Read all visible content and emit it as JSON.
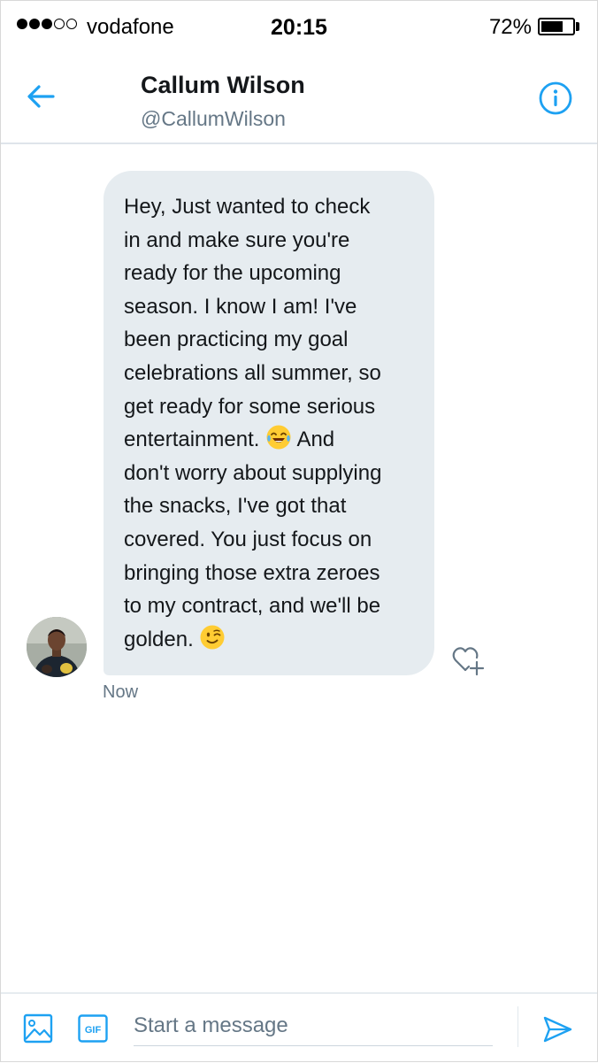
{
  "status_bar": {
    "signal_full": 3,
    "signal_total": 5,
    "carrier": "vodafone",
    "time": "20:15",
    "battery_percent_label": "72%",
    "battery_level": 0.72
  },
  "header": {
    "name": "Callum Wilson",
    "handle": "@CallumWilson",
    "back_icon": "arrow-left-icon",
    "info_icon": "info-circle-icon"
  },
  "message": {
    "lines": [
      "Hey, Just wanted to check",
      "in and make sure you're",
      "ready for the upcoming",
      "season. I know I am! I've",
      "been practicing my goal",
      "celebrations all summer, so",
      "get ready for some serious",
      "entertainment.",
      "And",
      "don't worry about supplying",
      "the snacks, I've got that",
      "covered. You just focus on",
      "bringing those extra zeroes",
      "to my contract, and we'll be",
      "golden."
    ],
    "emoji_1": "laughing-tears-emoji",
    "emoji_2": "winking-face-emoji",
    "timestamp": "Now",
    "like_icon": "heart-plus-icon"
  },
  "composer": {
    "placeholder": "Start a message",
    "media_icon": "image-icon",
    "gif_label": "GIF",
    "send_icon": "send-icon"
  },
  "colors": {
    "accent": "#1da1f2",
    "bubble": "#e6ecf0",
    "secondary_text": "#657786"
  }
}
